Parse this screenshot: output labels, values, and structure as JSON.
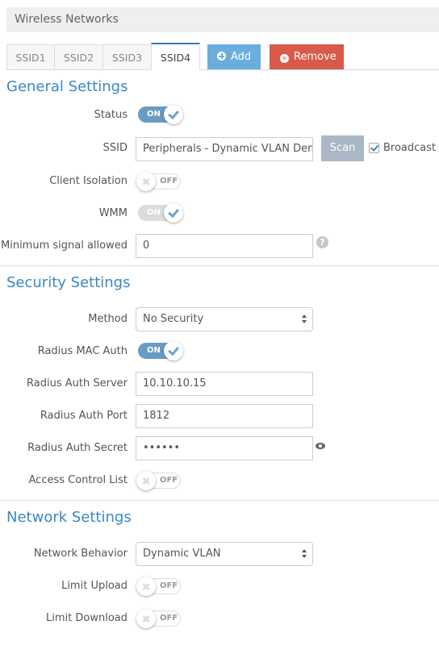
{
  "panel": {
    "title": "Wireless Networks"
  },
  "tabs": [
    {
      "label": "SSID1",
      "active": false
    },
    {
      "label": "SSID2",
      "active": false
    },
    {
      "label": "SSID3",
      "active": false
    },
    {
      "label": "SSID4",
      "active": true
    }
  ],
  "toolbar": {
    "add_label": "Add",
    "add_icon": "plus-circle-icon",
    "remove_label": "Remove",
    "remove_icon": "times-circle-icon",
    "add_color": "#6aaede",
    "remove_color": "#d9594a"
  },
  "general": {
    "title": "General Settings",
    "status": {
      "label": "Status",
      "state": "ON"
    },
    "ssid": {
      "label": "SSID",
      "value": "Peripherals - Dynamic VLAN Demo",
      "scan_label": "Scan",
      "broadcast_label": "Broadcast",
      "broadcast_checked": true
    },
    "client_isolation": {
      "label": "Client Isolation",
      "state": "OFF"
    },
    "wmm": {
      "label": "WMM",
      "state": "ON",
      "disabled": true
    },
    "min_signal": {
      "label": "Minimum signal allowed",
      "value": "0",
      "help_icon": "question-circle-icon"
    }
  },
  "security": {
    "title": "Security Settings",
    "method": {
      "label": "Method",
      "value": "No Security"
    },
    "radius_mac_auth": {
      "label": "Radius MAC Auth",
      "state": "ON"
    },
    "radius_auth_server": {
      "label": "Radius Auth Server",
      "value": "10.10.10.15"
    },
    "radius_auth_port": {
      "label": "Radius Auth Port",
      "value": "1812"
    },
    "radius_auth_secret": {
      "label": "Radius Auth Secret",
      "value": "••••••",
      "reveal_icon": "eye-icon"
    },
    "acl": {
      "label": "Access Control List",
      "state": "OFF"
    }
  },
  "network": {
    "title": "Network Settings",
    "behavior": {
      "label": "Network Behavior",
      "value": "Dynamic VLAN"
    },
    "limit_upload": {
      "label": "Limit Upload",
      "state": "OFF"
    },
    "limit_download": {
      "label": "Limit Download",
      "state": "OFF"
    }
  },
  "colors": {
    "accent": "#3b87c6",
    "toggle_on": "#6a9bc3",
    "scan": "#a9b8c4"
  }
}
